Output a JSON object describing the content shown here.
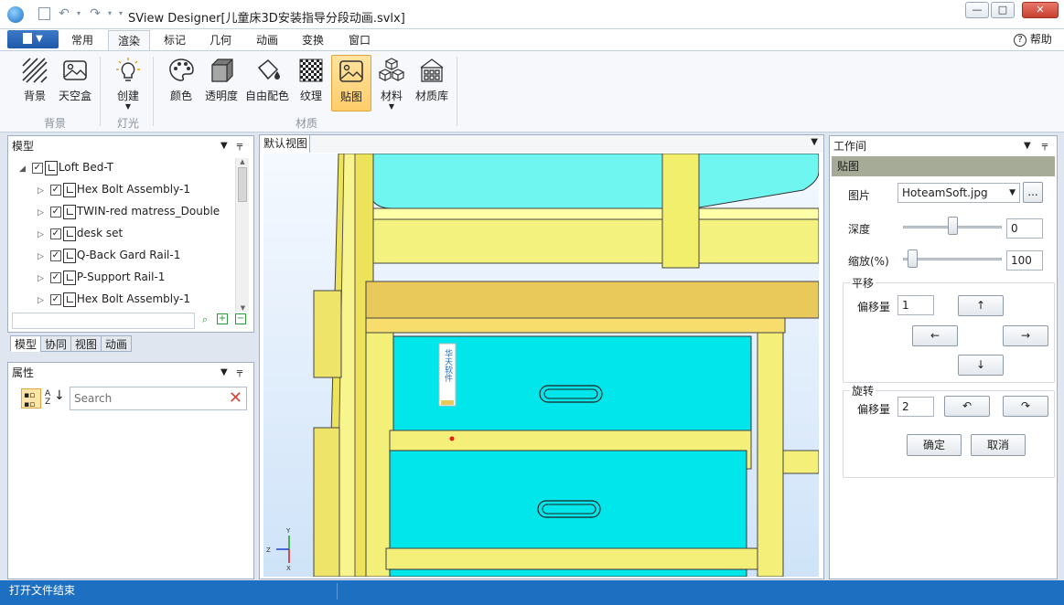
{
  "window": {
    "title": "SView Designer[儿童床3D安装指导分段动画.svlx]",
    "minimize": "—",
    "maximize": "□",
    "close": "✕"
  },
  "ribbon": {
    "tabs": [
      "常用",
      "渲染",
      "标记",
      "几何",
      "动画",
      "变换",
      "窗口"
    ],
    "active_tab": "渲染",
    "help": "帮助",
    "buttons": {
      "background": "背景",
      "skybox": "天空盒",
      "create": "创建",
      "color": "颜色",
      "transparency": "透明度",
      "free_color": "自由配色",
      "texture": "纹理",
      "decal": "贴图",
      "material": "材料",
      "material_lib": "材质库"
    },
    "groups": {
      "background": "背景",
      "light": "灯光",
      "material": "材质"
    }
  },
  "model_panel": {
    "title": "模型",
    "tree": [
      {
        "label": "Loft Bed-T",
        "level": 0
      },
      {
        "label": "Hex Bolt Assembly-1",
        "level": 1
      },
      {
        "label": "TWIN-red matress_Double",
        "level": 1
      },
      {
        "label": "desk set",
        "level": 1
      },
      {
        "label": "Q-Back Gard Rail-1",
        "level": 1
      },
      {
        "label": "P-Support Rail-1",
        "level": 1
      },
      {
        "label": "Hex Bolt Assembly-1",
        "level": 1
      }
    ],
    "tabs": [
      "模型",
      "协同",
      "视图",
      "动画"
    ]
  },
  "properties_panel": {
    "title": "属性",
    "search_placeholder": "Search"
  },
  "view": {
    "tab": "默认视图",
    "sticker_text": "华天软件"
  },
  "workspace": {
    "title": "工作间",
    "section": "贴图",
    "image_label": "图片",
    "image_value": "HoteamSoft.jpg",
    "browse": "...",
    "depth_label": "深度",
    "depth_value": "0",
    "depth_level": 0.5,
    "scale_label": "缩放(%)",
    "scale_value": "100",
    "scale_level": 0.05,
    "pan_label": "平移",
    "offset_label": "偏移量",
    "pan_offset": "1",
    "rotate_label": "旋转",
    "rotate_offset": "2",
    "up": "↑",
    "down": "↓",
    "left": "←",
    "right": "→",
    "rotate_ccw": "↶",
    "rotate_cw": "↷",
    "ok": "确定",
    "cancel": "取消"
  },
  "status": {
    "message": "打开文件结束"
  },
  "colors": {
    "accent": "#1d6fc2",
    "wood": "#f2f07a",
    "drawer": "#00e6ea"
  }
}
